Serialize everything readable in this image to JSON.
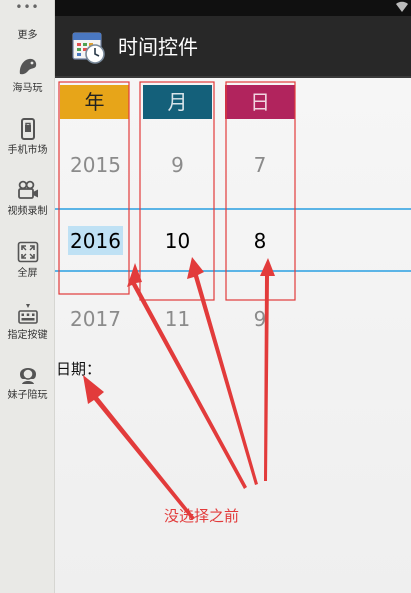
{
  "sidebar": {
    "more_label": "更多",
    "items": [
      {
        "label": "海马玩",
        "icon": "hippo-icon"
      },
      {
        "label": "手机市场",
        "icon": "market-icon"
      },
      {
        "label": "视频录制",
        "icon": "camera-icon"
      },
      {
        "label": "全屏",
        "icon": "fullscreen-icon"
      },
      {
        "label": "指定按键",
        "icon": "keyboard-icon"
      },
      {
        "label": "妹子陪玩",
        "icon": "girl-icon"
      }
    ]
  },
  "app": {
    "title": "时间控件",
    "icon": "calendar-clock-icon"
  },
  "picker": {
    "year": {
      "header": "年",
      "prev": "2015",
      "current": "2016",
      "next": "2017"
    },
    "month": {
      "header": "月",
      "prev": "9",
      "current": "10",
      "next": "11"
    },
    "day": {
      "header": "日",
      "prev": "7",
      "current": "8",
      "next": "9"
    }
  },
  "date_label": "日期：",
  "annotation": "没选择之前",
  "colors": {
    "year_header": "#e7a519",
    "month_header": "#14607a",
    "day_header": "#b1245d",
    "selection_line": "#5bb4e6",
    "annotation_red": "#e23b3b"
  }
}
